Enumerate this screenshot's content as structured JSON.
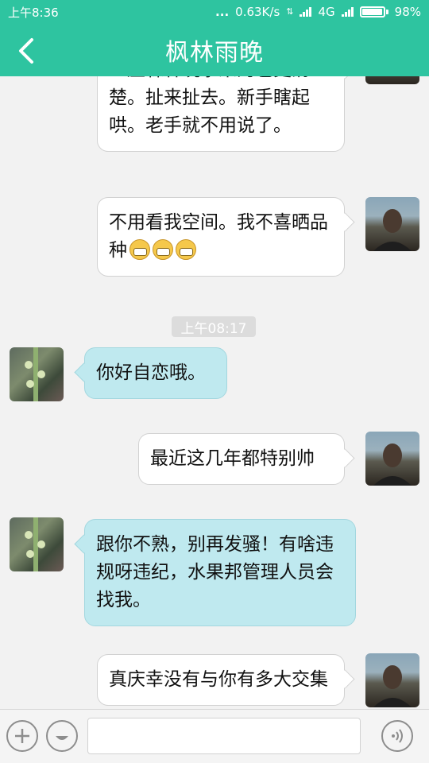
{
  "status_bar": {
    "time": "上午8:36",
    "dots": "...",
    "speed": "0.63K/s",
    "network": "4G",
    "battery": "98%",
    "battery_level": 0.98
  },
  "header": {
    "title": "枫林雨晚",
    "back_icon": "chevron-left-icon"
  },
  "messages": [
    {
      "side": "right",
      "text": "一座森林玩水果的也更清楚。扯来扯去。新手瞎起哄。老手就不用说了。"
    },
    {
      "side": "right",
      "text": "不用看我空间。我不喜晒品种",
      "emoji_count": 3
    },
    {
      "side": "left",
      "text": "你好自恋哦。"
    },
    {
      "side": "right",
      "text": "最近这几年都特别帅"
    },
    {
      "side": "left",
      "text": "跟你不熟，别再发骚！有啥违规呀违纪，水果邦管理人员会找我。"
    },
    {
      "side": "right",
      "text": "真庆幸没有与你有多大交集"
    }
  ],
  "timestamp": "上午08:17",
  "input_bar": {
    "placeholder": "",
    "plus_icon": "plus-icon",
    "emoji_icon": "emoji-icon",
    "voice_icon": "voice-icon"
  }
}
